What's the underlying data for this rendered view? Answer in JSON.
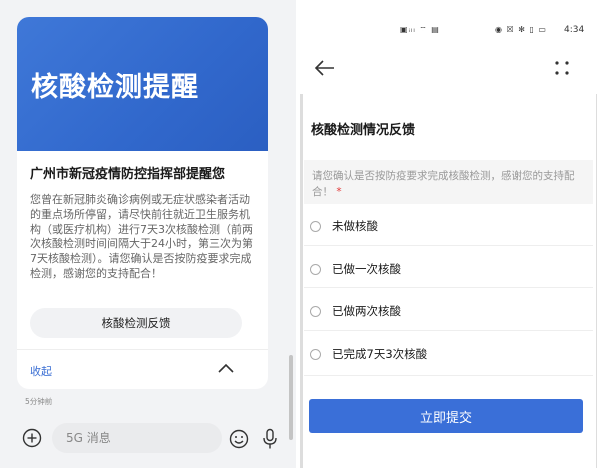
{
  "chat": {
    "card": {
      "banner_title": "核酸检测提醒",
      "heading": "广州市新冠疫情防控指挥部提醒您",
      "body": "您曾在新冠肺炎确诊病例或无症状感染者活动的重点场所停留，请尽快前往就近卫生服务机构（或医疗机构）进行7天3次核酸检测（前两次核酸检测时间间隔大于24小时，第三次为第7天核酸检测）。请您确认是否按防疫要求完成检测，感谢您的支持配合！",
      "feedback_button": "核酸检测反馈",
      "collapse_label": "收起"
    },
    "timestamp": "5分钟前",
    "input_placeholder": "5G 消息",
    "icons": [
      "plus-circle-icon",
      "emoji-icon",
      "microphone-icon",
      "chevron-up-icon"
    ]
  },
  "survey": {
    "status_bar": {
      "left_indicators": "▣ᵢₗₗ ⌔ ▤",
      "right_indicators": "◉ ☒ ✻ ▯ ▭",
      "time": "4:34"
    },
    "form_title": "核酸检测情况反馈",
    "question": "请您确认是否按防疫要求完成核酸检测，感谢您的支持配合！",
    "required_mark": "*",
    "options": [
      {
        "label": "未做核酸"
      },
      {
        "label": "已做一次核酸"
      },
      {
        "label": "已做两次核酸"
      },
      {
        "label": "已完成7天3次核酸"
      }
    ],
    "submit_label": "立即提交",
    "icons": [
      "back-arrow-icon",
      "more-icon"
    ]
  },
  "colors": {
    "accent": "#3a6fd8",
    "banner": "#3168cc",
    "required": "#e23a3a"
  }
}
